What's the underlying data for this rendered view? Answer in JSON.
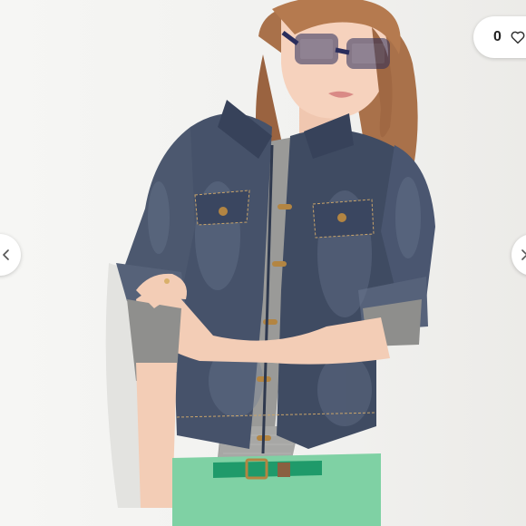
{
  "listing": {
    "like_count": "0"
  },
  "icons": {
    "like": "heart-outline-icon",
    "prev": "chevron-left-icon",
    "next": "chevron-right-icon"
  },
  "colors": {
    "denim": "#3e4a5c",
    "shirt": "#9a9a98",
    "pants": "#7fd1a4",
    "belt": "#1f9a6a",
    "hair": "#a9714a",
    "glasses": "#2a2d5c",
    "background": "#f2f2f0"
  }
}
